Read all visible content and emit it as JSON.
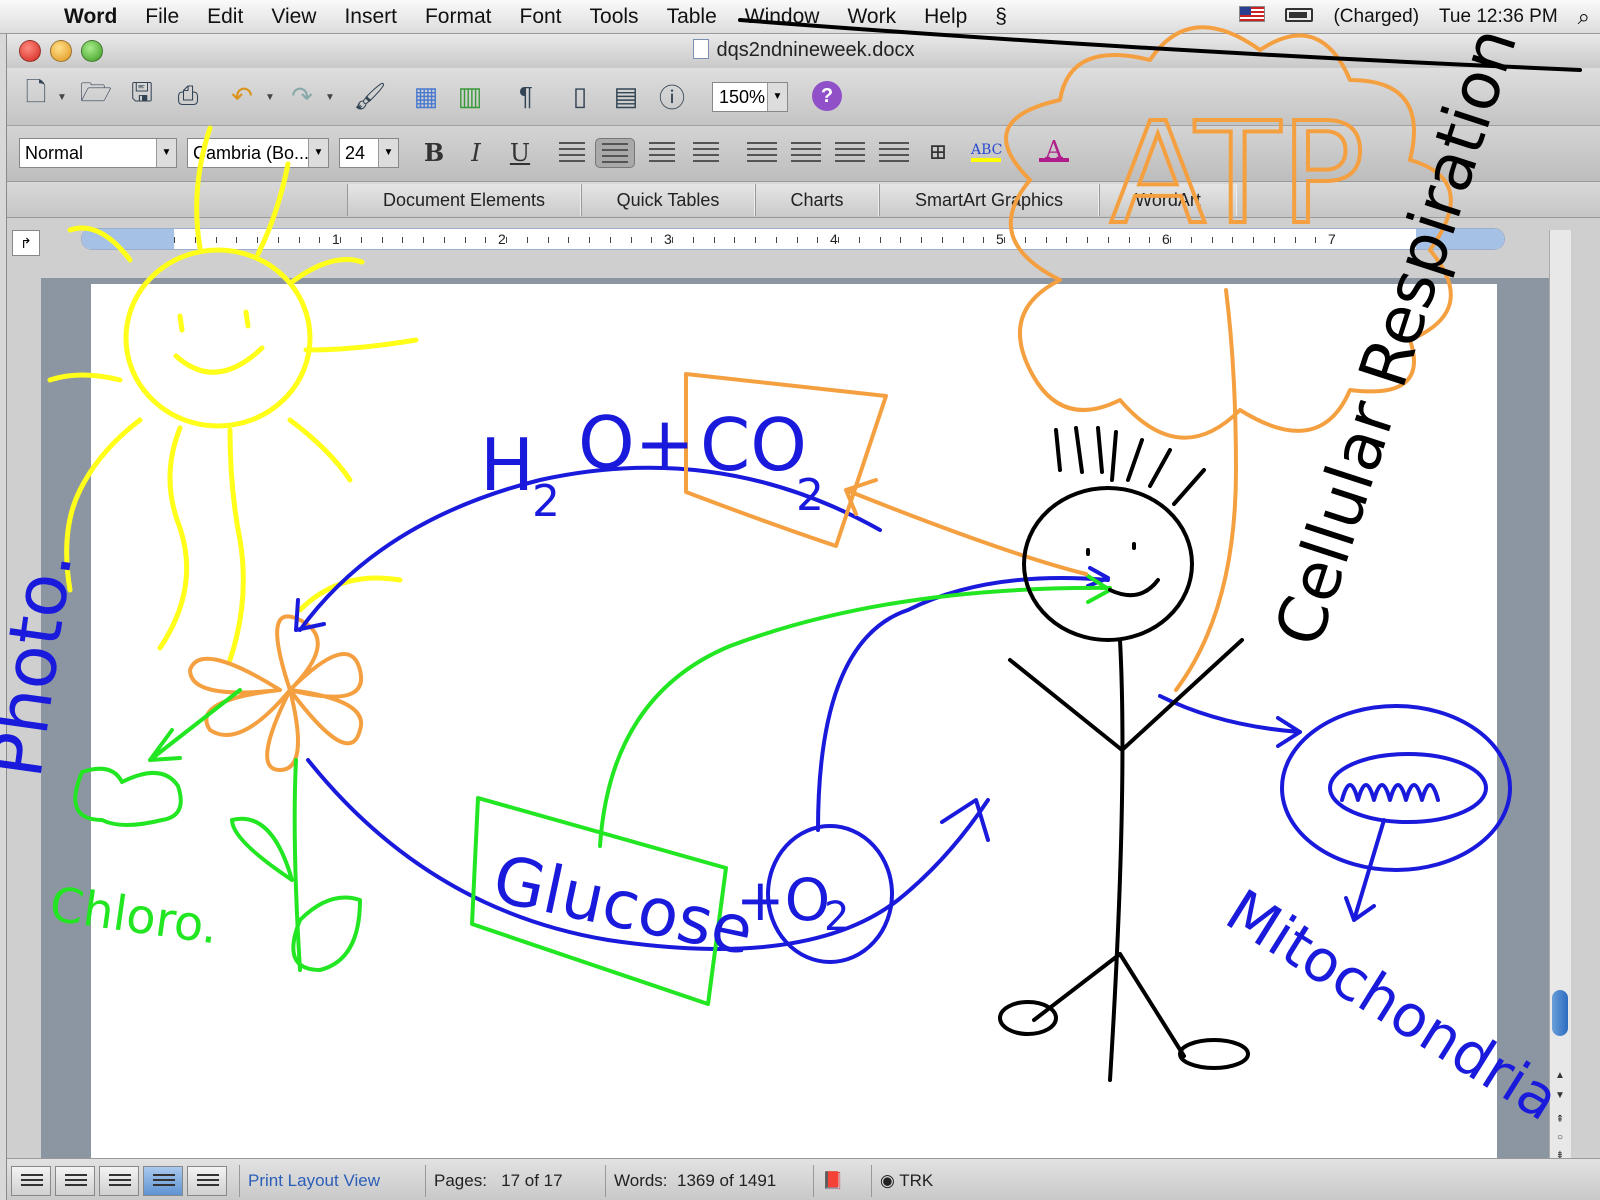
{
  "menubar": {
    "app": "Word",
    "items": [
      "File",
      "Edit",
      "View",
      "Insert",
      "Format",
      "Font",
      "Tools",
      "Table",
      "Window",
      "Work",
      "Help"
    ],
    "battery": "(Charged)",
    "clock": "Tue 12:36 PM"
  },
  "window": {
    "title": "dqs2ndnineweek.docx"
  },
  "toolbar": {
    "zoom": "150%",
    "help": "?"
  },
  "format": {
    "style": "Normal",
    "font": "Cambria (Bo...",
    "size": "24",
    "bold": "B",
    "italic": "I",
    "underline": "U",
    "pilcrow": "¶"
  },
  "gallery": {
    "tabs": [
      "Document Elements",
      "Quick Tables",
      "Charts",
      "SmartArt Graphics",
      "WordArt"
    ]
  },
  "ruler": {
    "numbers": [
      "1",
      "2",
      "3",
      "4",
      "5",
      "6",
      "7"
    ]
  },
  "statusbar": {
    "view": "Print Layout View",
    "pages_label": "Pages:",
    "pages": "17 of 17",
    "words_label": "Words:",
    "words": "1369 of 1491",
    "trk": "TRK"
  },
  "drawing": {
    "photo": "Photo.",
    "chloro": "Chloro.",
    "h2o": "H",
    "h2o_sub": "2",
    "h2o_o": "O+",
    "co2": "CO",
    "co2_sub": "2",
    "glucose": "Glucose",
    "o2": "+O",
    "o2_sub": "2",
    "atp": "ATP",
    "cellular": "Cellular Respiration",
    "mito": "Mitochondria"
  },
  "colors": {
    "sun": "#ffff1a",
    "green": "#22e622",
    "blue": "#1a1adc",
    "orange": "#f5a040",
    "black": "#000000"
  }
}
